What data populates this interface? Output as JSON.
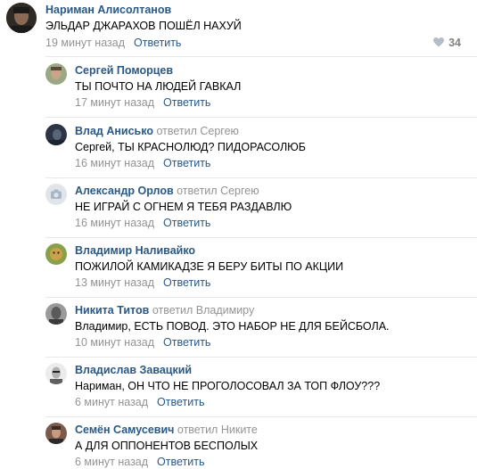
{
  "top_comment": {
    "author": "Нариман Алисолтанов",
    "text": "ЭЛЬДАР ДЖАРАХОВ ПОШЁЛ НАХУЙ",
    "time": "19 минут назад",
    "reply_label": "Ответить",
    "likes": "34",
    "avatar_color": "#3a3530"
  },
  "replies": [
    {
      "author": "Сергей Поморцев",
      "replied": "",
      "replied_to": "",
      "text": "ТЫ ПОЧТО НА ЛЮДЕЙ ГАВКАЛ",
      "time": "17 минут назад",
      "reply_label": "Ответить",
      "avatar_color": "#6b7a58"
    },
    {
      "author": "Влад Анисько",
      "replied": "ответил",
      "replied_to": "Сергею",
      "text": "Сергей, ТЫ КРАСНОЛЮД? ПИДОРАСОЛЮБ",
      "time": "16 минут назад",
      "reply_label": "Ответить",
      "avatar_color": "#2c3445"
    },
    {
      "author": "Александр Орлов",
      "replied": "ответил",
      "replied_to": "Сергею",
      "text": "НЕ ИГРАЙ С ОГНЕМ Я ТЕБЯ РАЗДАВЛЮ",
      "time": "16 минут назад",
      "reply_label": "Ответить",
      "avatar_color": "#e1e5eb"
    },
    {
      "author": "Владимир Наливайко",
      "replied": "",
      "replied_to": "",
      "text": "ПОЖИЛОЙ КАМИКАДЗЕ Я БЕРУ БИТЫ ПО АКЦИИ",
      "time": "13 минут назад",
      "reply_label": "Ответить",
      "avatar_color": "#8aa048"
    },
    {
      "author": "Никита Титов",
      "replied": "ответил",
      "replied_to": "Владимиру",
      "text": "Владимир, ЕСТЬ ПОВОД. ЭТО НАБОР НЕ ДЛЯ БЕЙСБОЛА.",
      "time": "10 минут назад",
      "reply_label": "Ответить",
      "avatar_color": "#7a7a7a"
    },
    {
      "author": "Владислав Завацкий",
      "replied": "",
      "replied_to": "",
      "text": "Нариман, ОН ЧТО НЕ ПРОГОЛОСОВАЛ ЗА ТОП ФЛОУ???",
      "time": "6 минут назад",
      "reply_label": "Ответить",
      "avatar_color": "#e9e9e9"
    },
    {
      "author": "Семён Самусевич",
      "replied": "ответил",
      "replied_to": "Никите",
      "text": "А ДЛЯ ОППОНЕНТОВ БЕСПОЛЫХ",
      "time": "6 минут назад",
      "reply_label": "Ответить",
      "avatar_color": "#7a5a4a"
    }
  ],
  "colors": {
    "link": "#2a5885",
    "meta": "#939393",
    "divider": "#e7e8ec"
  }
}
